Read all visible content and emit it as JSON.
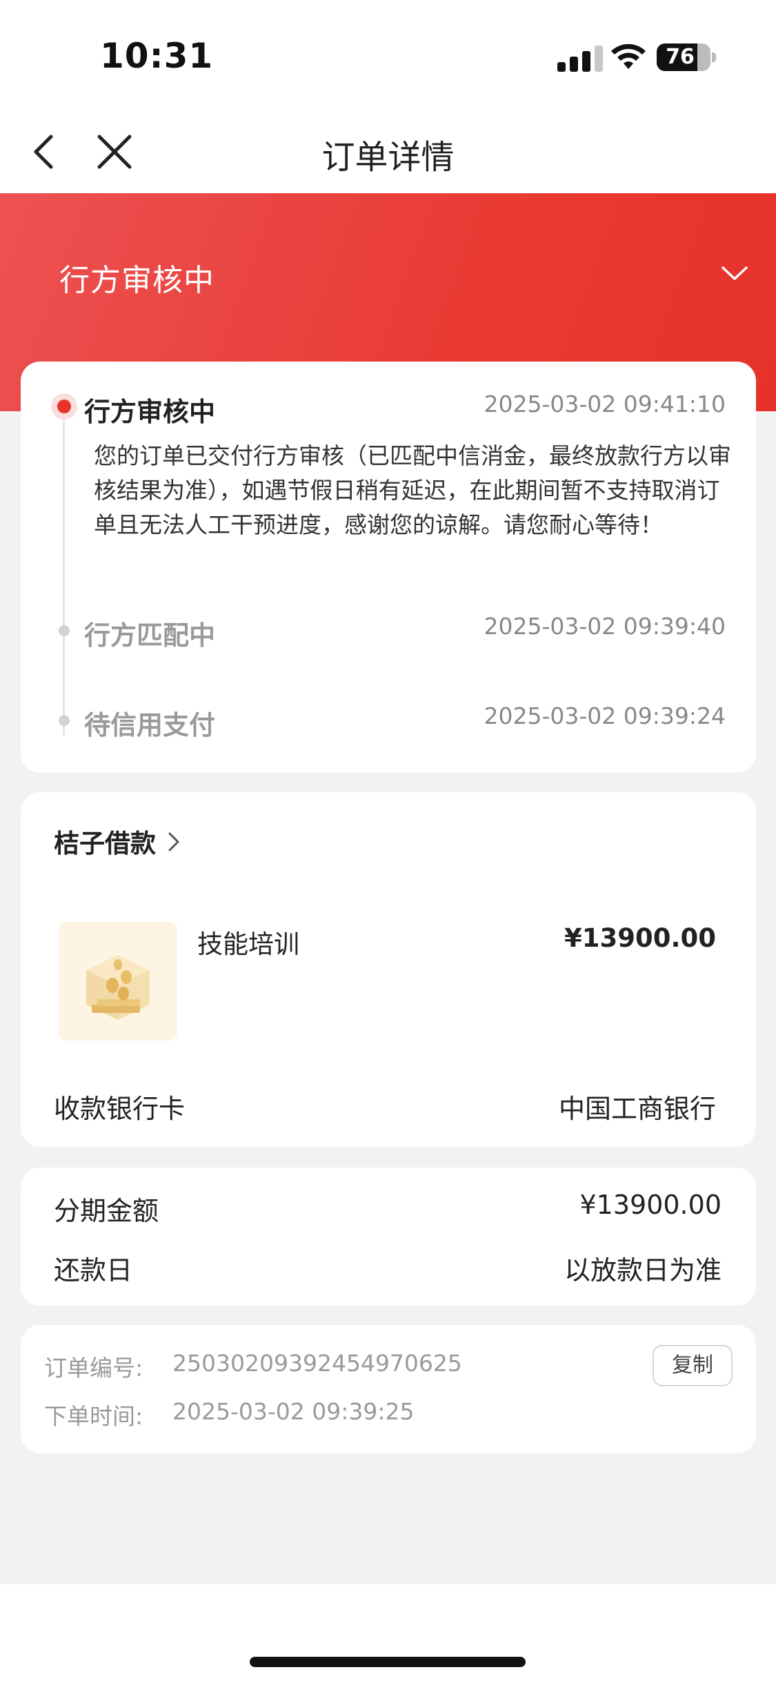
{
  "status_bar": {
    "time": "10:31",
    "battery": "76",
    "battery_level": 0.76
  },
  "nav": {
    "title": "订单详情"
  },
  "banner": {
    "title": "行方审核中"
  },
  "timeline": {
    "items": [
      {
        "title": "行方审核中",
        "time": "2025-03-02 09:41:10",
        "desc": "您的订单已交付行方审核（已匹配中信消金，最终放款行方以审核结果为准），如遇节假日稍有延迟，在此期间暂不支持取消订单且无法人工干预进度，感谢您的谅解。请您耐心等待！"
      },
      {
        "title": "行方匹配中",
        "time": "2025-03-02 09:39:40"
      },
      {
        "title": "待信用支付",
        "time": "2025-03-02 09:39:24"
      }
    ]
  },
  "product": {
    "merchant": "桔子借款",
    "name": "技能培训",
    "price": "¥13900.00",
    "bank_label": "收款银行卡",
    "bank_value": "中国工商银行"
  },
  "amount": {
    "installment_label": "分期金额",
    "installment_value": "¥13900.00",
    "repay_label": "还款日",
    "repay_value": "以放款日为准"
  },
  "order": {
    "number_label": "订单编号:",
    "number_value": "25030209392454970625",
    "time_label": "下单时间:",
    "time_value": "2025-03-02 09:39:25",
    "copy_label": "复制"
  },
  "colors": {
    "accent": "#e8322c",
    "banner_start": "#ec5152",
    "banner_end": "#e6322a"
  }
}
